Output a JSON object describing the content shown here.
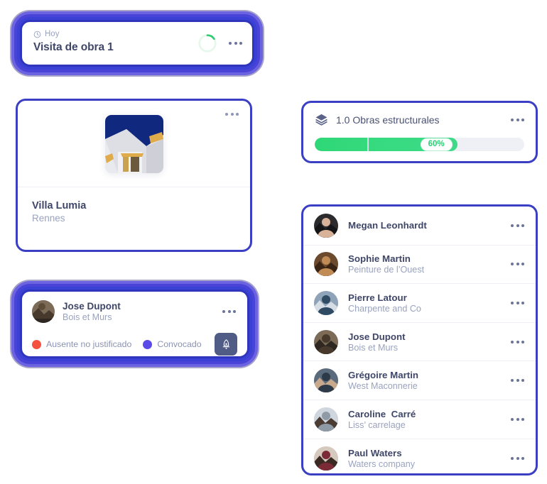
{
  "visit_card": {
    "meta_label": "Hoy",
    "clock_icon": "clock-icon",
    "title": "Visita de obra 1",
    "progress_ring": {
      "icon": "progress-ring-icon",
      "percent": 25,
      "color": "#2ecc71",
      "track_color": "#e6f7ec"
    },
    "menu_icon": "more-options-icon"
  },
  "project_card": {
    "thumbnail_alt": "building-photo",
    "title": "Villa Lumia",
    "subtitle": "Rennes",
    "menu_icon": "more-options-icon"
  },
  "worker_card": {
    "avatar": "avatar-jose-dupont",
    "name": "Jose Dupont",
    "role": "Bois et Murs",
    "menu_icon": "more-options-icon",
    "legend": [
      {
        "label": "Ausente no justificado",
        "color": "#f4523f"
      },
      {
        "label": "Convocado",
        "color": "#5a4ae8"
      }
    ],
    "action_button": {
      "icon": "pen-nib-icon",
      "background": "#515c86"
    }
  },
  "progress_card": {
    "icon": "layers-icon",
    "title": "1.0 Obras estructurales",
    "menu_icon": "more-options-icon",
    "progress": {
      "percent_label": "60%",
      "fill_percent": 68,
      "tick_percent": 25,
      "fill_color": "#33d97e",
      "track_color": "#eef0f5",
      "badge_text_color": "#2ecf74"
    }
  },
  "people_card": {
    "people": [
      {
        "avatar": "avatar-megan-leonhardt",
        "name": "Megan Leonhardt",
        "company": "",
        "menu_icon": "more-options-icon"
      },
      {
        "avatar": "avatar-sophie-martin",
        "name": "Sophie Martin",
        "company": "Peinture de l’Ouest",
        "menu_icon": "more-options-icon"
      },
      {
        "avatar": "avatar-pierre-latour",
        "name": "Pierre Latour",
        "company": "Charpente and Co",
        "menu_icon": "more-options-icon"
      },
      {
        "avatar": "avatar-jose-dupont",
        "name": "Jose Dupont",
        "company": "Bois et Murs",
        "menu_icon": "more-options-icon"
      },
      {
        "avatar": "avatar-gregoire-martin",
        "name": "Grégoire Martin",
        "company": "West Maconnerie",
        "menu_icon": "more-options-icon"
      },
      {
        "avatar": "avatar-caroline-carre",
        "name": "Caroline  Carré",
        "company": "Liss’ carrelage",
        "menu_icon": "more-options-icon"
      },
      {
        "avatar": "avatar-paul-waters",
        "name": "Paul Waters",
        "company": "Waters company",
        "menu_icon": "more-options-icon"
      }
    ]
  },
  "theme": {
    "card_border": "#3a3fc4",
    "halo_inner": "#2f35bd",
    "title_text": "#3f4668",
    "muted_text": "#9aa3bf",
    "background": "#ffffff"
  }
}
